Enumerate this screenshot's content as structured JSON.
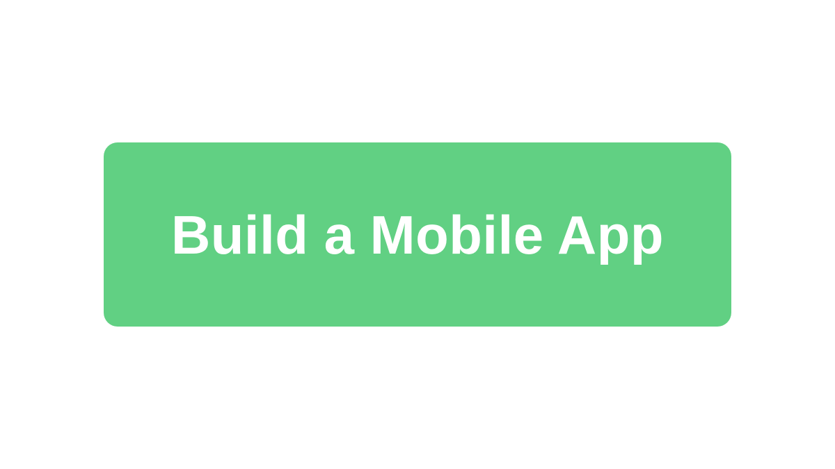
{
  "cta": {
    "label": "Build a Mobile App",
    "background_color": "#61d083",
    "text_color": "#ffffff"
  },
  "page": {
    "background_color": "#ffffff"
  }
}
